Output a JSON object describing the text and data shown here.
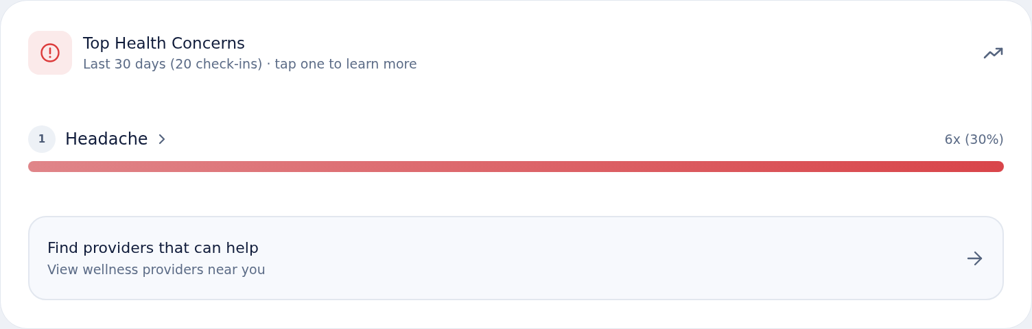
{
  "header": {
    "title": "Top Health Concerns",
    "subtitle": "Last 30 days (20 check-ins) · tap one to learn more"
  },
  "concerns": [
    {
      "rank": "1",
      "name": "Headache",
      "count": "6x (30%)",
      "level": 1
    }
  ],
  "cta": {
    "title": "Find providers that can help",
    "subtitle": "View wellness providers near you"
  }
}
